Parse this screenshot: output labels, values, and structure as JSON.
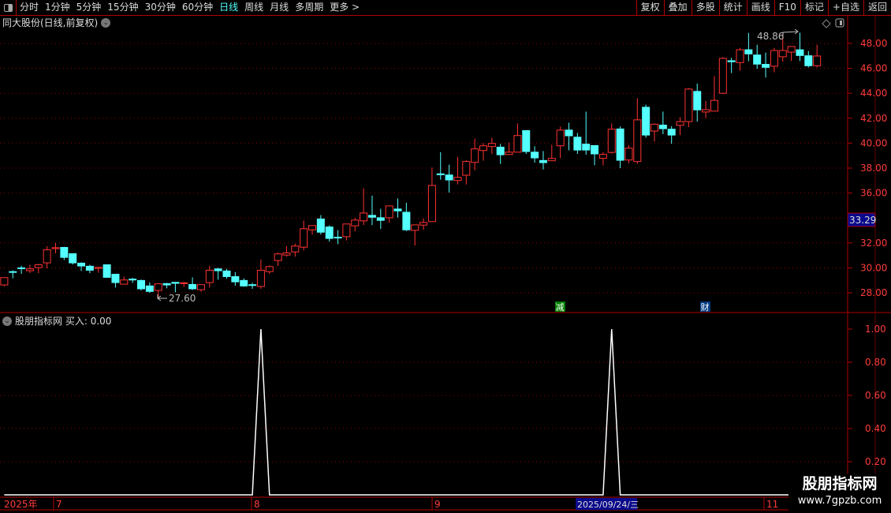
{
  "toolbar": {
    "periods": [
      "分时",
      "1分钟",
      "5分钟",
      "15分钟",
      "30分钟",
      "60分钟",
      "日线",
      "周线",
      "月线",
      "多周期",
      "更多 >"
    ],
    "active_period": "日线",
    "buttons": [
      "复权",
      "叠加",
      "多股",
      "统计",
      "画线",
      "F10",
      "标记",
      "+自选",
      "返回"
    ]
  },
  "main_chart": {
    "title": "同大股份(日线,前复权)",
    "price_axis": [
      "48.00",
      "46.00",
      "44.00",
      "42.00",
      "40.00",
      "38.00",
      "36.00",
      "32.00",
      "30.00",
      "28.00"
    ],
    "current_price_label": "33.29",
    "high_annotation": "48.86",
    "low_annotation": "27.60",
    "markers": [
      {
        "text": "减",
        "color": "#008000"
      },
      {
        "text": "财",
        "color": "#003a80"
      }
    ]
  },
  "indicator": {
    "name": "股朋指标网",
    "readout": "买入: 0.00",
    "axis": [
      "1.00",
      "0.80",
      "0.60",
      "0.40",
      "0.20"
    ]
  },
  "time_axis": {
    "labels": [
      "2025年",
      "7",
      "8",
      "9",
      "11"
    ],
    "cursor_date": "2025/09/24/三"
  },
  "watermark": {
    "line1": "股朋指标网",
    "line2": "www.7gpzb.com"
  },
  "colors": {
    "up": "#ff3232",
    "down": "#54ffff",
    "grid": "#8b0000",
    "axis": "#ff3c3c",
    "frame": "#b00000",
    "cursor_bg": "#0a0a8c"
  },
  "chart_data": {
    "type": "candlestick",
    "ylim": [
      27,
      49
    ],
    "candles_ohlc": [
      [
        28.63,
        29.22,
        28.53,
        29.22
      ],
      [
        29.7,
        29.8,
        29.16,
        29.65
      ],
      [
        30.0,
        30.17,
        29.52,
        29.98
      ],
      [
        29.77,
        30.25,
        29.58,
        29.92
      ],
      [
        30.02,
        30.33,
        29.58,
        30.25
      ],
      [
        30.4,
        31.75,
        29.96,
        31.45
      ],
      [
        31.54,
        32.0,
        31.16,
        31.62
      ],
      [
        31.64,
        31.68,
        30.63,
        30.84
      ],
      [
        31.14,
        31.14,
        30.27,
        30.4
      ],
      [
        30.38,
        30.44,
        29.75,
        30.15
      ],
      [
        30.13,
        30.25,
        29.58,
        29.81
      ],
      [
        29.96,
        30.04,
        29.62,
        30.04
      ],
      [
        30.25,
        30.25,
        29.2,
        29.24
      ],
      [
        29.49,
        29.49,
        28.42,
        28.82
      ],
      [
        28.69,
        29.3,
        28.69,
        29.03
      ],
      [
        29.1,
        29.2,
        28.8,
        29.03
      ],
      [
        28.99,
        29.05,
        28.19,
        28.32
      ],
      [
        28.55,
        28.84,
        28.0,
        28.11
      ],
      [
        28.19,
        28.72,
        27.6,
        28.72
      ],
      [
        28.74,
        28.8,
        28.36,
        28.63
      ],
      [
        28.84,
        28.84,
        28.04,
        28.76
      ],
      [
        28.74,
        28.88,
        28.48,
        28.8
      ],
      [
        28.67,
        29.24,
        28.23,
        28.32
      ],
      [
        28.25,
        28.65,
        28.1,
        28.65
      ],
      [
        28.82,
        30.17,
        28.42,
        29.81
      ],
      [
        29.92,
        30.0,
        29.05,
        29.77
      ],
      [
        29.75,
        29.92,
        29.12,
        29.3
      ],
      [
        29.3,
        29.66,
        28.57,
        28.88
      ],
      [
        28.99,
        29.16,
        28.48,
        28.55
      ],
      [
        28.65,
        28.8,
        28.32,
        28.59
      ],
      [
        28.51,
        30.67,
        28.32,
        29.81
      ],
      [
        29.7,
        30.19,
        29.52,
        30.1
      ],
      [
        30.59,
        31.22,
        30.15,
        31.12
      ],
      [
        31.03,
        31.75,
        30.9,
        31.2
      ],
      [
        31.28,
        31.94,
        30.9,
        31.75
      ],
      [
        31.66,
        33.79,
        31.41,
        33.14
      ],
      [
        33.05,
        33.39,
        32.67,
        33.39
      ],
      [
        33.92,
        34.23,
        32.67,
        32.86
      ],
      [
        33.28,
        33.41,
        32.1,
        32.36
      ],
      [
        32.46,
        33.03,
        31.9,
        32.4
      ],
      [
        32.5,
        33.52,
        32.2,
        33.52
      ],
      [
        33.37,
        34.0,
        32.93,
        33.83
      ],
      [
        33.77,
        36.38,
        33.43,
        34.4
      ],
      [
        34.21,
        35.79,
        33.43,
        34.06
      ],
      [
        34.02,
        34.74,
        33.12,
        33.81
      ],
      [
        34.02,
        34.97,
        33.62,
        34.97
      ],
      [
        34.72,
        35.56,
        34.04,
        34.57
      ],
      [
        34.46,
        35.22,
        32.95,
        33.05
      ],
      [
        33.01,
        33.45,
        31.79,
        33.45
      ],
      [
        33.43,
        33.96,
        33.05,
        33.64
      ],
      [
        33.71,
        38.04,
        33.71,
        36.61
      ],
      [
        37.54,
        39.28,
        37.07,
        37.47
      ],
      [
        37.45,
        38.27,
        36.04,
        37.05
      ],
      [
        37.01,
        38.9,
        36.69,
        37.26
      ],
      [
        37.43,
        38.65,
        36.69,
        38.53
      ],
      [
        38.46,
        40.36,
        37.83,
        39.54
      ],
      [
        39.41,
        40.0,
        38.59,
        39.79
      ],
      [
        39.73,
        40.44,
        39.14,
        39.98
      ],
      [
        39.68,
        39.94,
        38.34,
        39.07
      ],
      [
        39.09,
        40.06,
        39.09,
        39.28
      ],
      [
        39.28,
        41.58,
        39.28,
        40.61
      ],
      [
        41.01,
        41.01,
        39.14,
        39.33
      ],
      [
        39.28,
        39.75,
        38.44,
        38.82
      ],
      [
        38.61,
        39.37,
        37.89,
        38.44
      ],
      [
        38.59,
        39.87,
        38.59,
        38.78
      ],
      [
        39.79,
        41.33,
        38.8,
        41.05
      ],
      [
        41.05,
        41.64,
        39.43,
        40.59
      ],
      [
        40.48,
        40.82,
        39.14,
        39.45
      ],
      [
        39.92,
        42.53,
        39.07,
        39.45
      ],
      [
        39.81,
        39.81,
        38.23,
        39.14
      ],
      [
        38.78,
        39.28,
        38.23,
        39.1
      ],
      [
        39.26,
        41.58,
        39.16,
        41.12
      ],
      [
        41.14,
        41.33,
        38.0,
        38.63
      ],
      [
        38.65,
        39.83,
        38.38,
        39.6
      ],
      [
        38.53,
        43.6,
        38.34,
        41.87
      ],
      [
        42.88,
        43.09,
        40.44,
        40.65
      ],
      [
        40.97,
        41.58,
        40.13,
        41.52
      ],
      [
        41.45,
        42.53,
        40.72,
        41.16
      ],
      [
        41.12,
        41.37,
        39.96,
        40.65
      ],
      [
        41.43,
        42.08,
        40.65,
        41.73
      ],
      [
        41.73,
        44.42,
        41.28,
        44.34
      ],
      [
        44.15,
        44.78,
        41.73,
        42.67
      ],
      [
        42.5,
        43.39,
        42.04,
        42.69
      ],
      [
        42.57,
        45.37,
        42.57,
        43.43
      ],
      [
        44.0,
        46.9,
        43.94,
        46.8
      ],
      [
        46.61,
        46.84,
        45.62,
        46.53
      ],
      [
        46.46,
        47.64,
        45.81,
        47.49
      ],
      [
        47.49,
        48.84,
        46.57,
        47.16
      ],
      [
        47.07,
        47.89,
        45.96,
        46.34
      ],
      [
        46.32,
        47.26,
        45.26,
        46.08
      ],
      [
        46.17,
        47.64,
        45.68,
        47.43
      ],
      [
        46.93,
        48.76,
        46.53,
        47.43
      ],
      [
        47.3,
        47.75,
        46.59,
        47.75
      ],
      [
        47.49,
        48.86,
        46.59,
        47.03
      ],
      [
        47.01,
        47.39,
        46.08,
        46.21
      ],
      [
        46.21,
        47.89,
        46.08,
        46.99
      ]
    ],
    "indicator_signal_indices": [
      30,
      71
    ],
    "indicator_ylim": [
      0,
      1.05
    ]
  }
}
